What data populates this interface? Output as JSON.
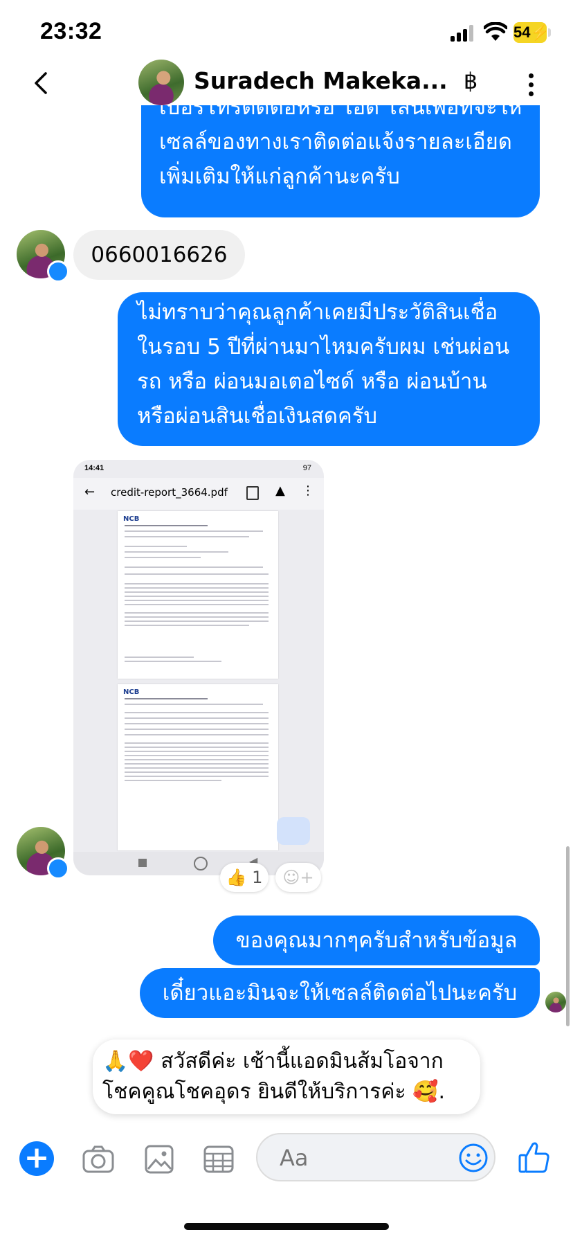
{
  "status_bar": {
    "time": "23:32",
    "battery": "54"
  },
  "header": {
    "contact_name": "Suradech Makeka...",
    "currency_icon": "฿"
  },
  "messages": {
    "out_1": [
      "เบอร์โทรติดต่อหรือ ไอดี ไลน์เพื่อที่จะให้",
      "เซลล์ของทางเราติดต่อแจ้งรายละเอียด",
      "เพิ่มเติมให้แก่ลูกค้านะครับ"
    ],
    "in_1": "0660016626",
    "out_2": [
      "ไม่ทราบว่าคุณลูกค้าเคยมีประวัติสินเชื่อ",
      "ในรอบ 5 ปีที่ผ่านมาไหมครับผม เช่นผ่อน",
      "รถ หรือ ผ่อนมอเตอไซด์ หรือ ผ่อนบ้าน",
      "หรือผ่อนสินเชื่อเงินสดครับ"
    ],
    "attachment": {
      "time": "14:41",
      "battery": "97",
      "filename": "credit-report_3664.pdf",
      "logo": "NCB"
    },
    "reaction": {
      "emoji": "👍",
      "count": "1"
    },
    "out_3": "ของคุณมากๆครับสำหรับข้อมูล",
    "out_4": "เดี๋ยวแอะมินจะให้เซลล์ติดต่อไปนะครับ"
  },
  "greeting": {
    "line1": "🙏❤️ สวัสดีค่ะ เช้านี้แอดมินส้มโอจาก",
    "line2": "โชคคูณโชคอุดร ยินดีให้บริการค่ะ 🥰."
  },
  "composer": {
    "placeholder": "Aa"
  },
  "colors": {
    "bubble_out": "#0a7cff",
    "bubble_in": "#f0f0f0",
    "accent": "#0a7cff"
  }
}
